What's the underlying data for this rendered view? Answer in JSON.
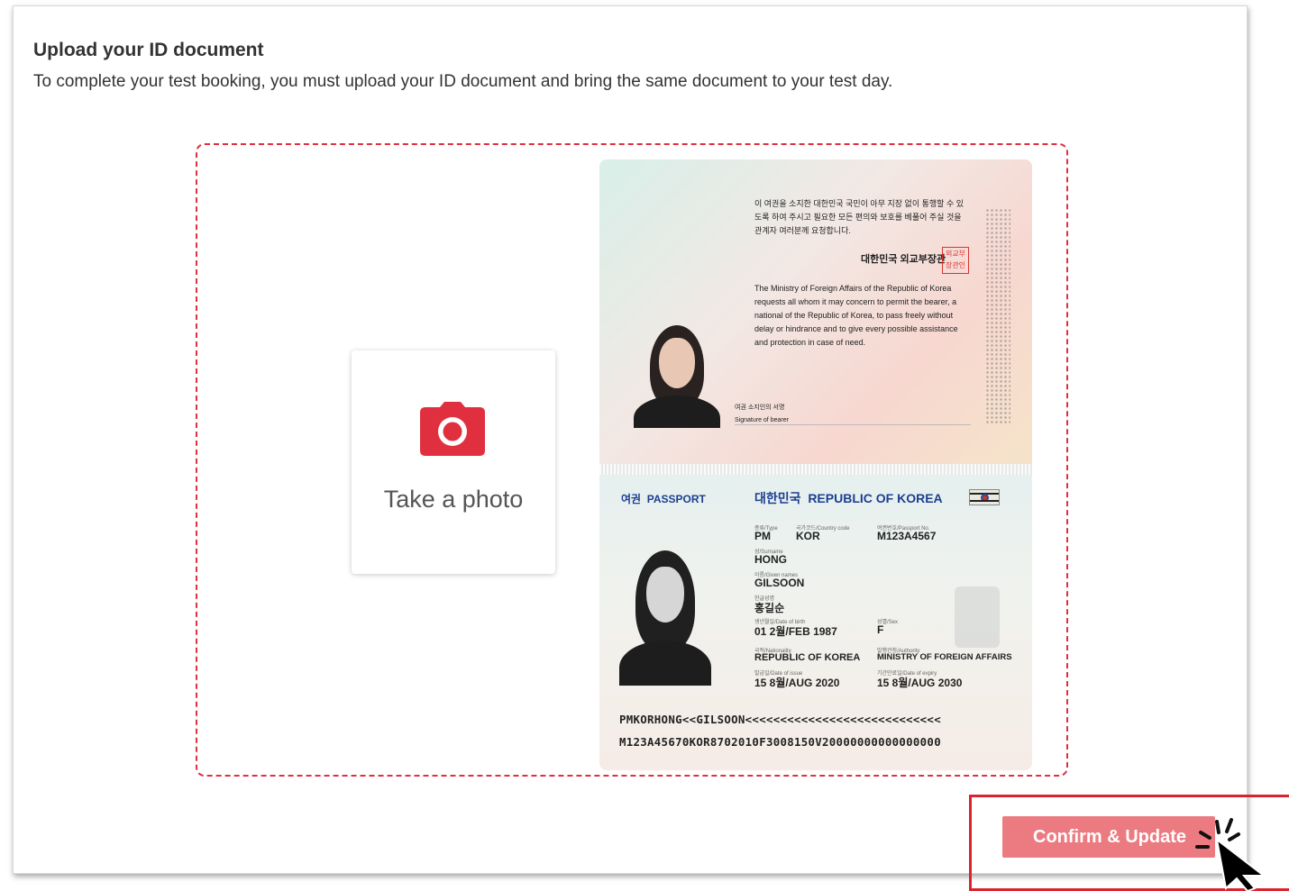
{
  "upload": {
    "title": "Upload your ID document",
    "subtitle": "To complete your test booking, you must upload your ID document and bring the same document to your test day."
  },
  "take_photo": {
    "label": "Take a photo",
    "icon": "camera-icon"
  },
  "passport": {
    "data_page": {
      "kr_label": "여권",
      "en_label": "PASSPORT",
      "country_kr": "대한민국",
      "country_en": "REPUBLIC OF KOREA",
      "fields": {
        "type": {
          "label": "종류/Type",
          "value": "PM"
        },
        "country_code": {
          "label": "국가코드/Country code",
          "value": "KOR"
        },
        "passport_no": {
          "label": "여권번호/Passport No.",
          "value": "M123A4567"
        },
        "surname": {
          "label": "성/Surname",
          "value": "HONG"
        },
        "given_names": {
          "label": "이름/Given names",
          "value": "GILSOON"
        },
        "korean_name": {
          "label": "한글성명",
          "value": "홍길순"
        },
        "date_of_birth": {
          "label": "생년월일/Date of birth",
          "value": "01 2월/FEB 1987"
        },
        "sex": {
          "label": "성별/Sex",
          "value": "F"
        },
        "nationality": {
          "label": "국적/Nationality",
          "value": "REPUBLIC OF KOREA"
        },
        "authority": {
          "label": "발행관청/Authority",
          "value": "MINISTRY OF FOREIGN AFFAIRS"
        },
        "date_of_issue": {
          "label": "발급일/Date of issue",
          "value": "15 8월/AUG 2020"
        },
        "date_of_expiry": {
          "label": "기간만료일/Date of expiry",
          "value": "15 8월/AUG 2030"
        }
      },
      "mrz_line1": "PMKORHONG<<GILSOON<<<<<<<<<<<<<<<<<<<<<<<<<<<<",
      "mrz_line2": "M123A45670KOR8702010F3008150V20000000000000000"
    },
    "request_page": {
      "kr_text": "이 여권을 소지한 대한민국 국민이 아무 지장 없이 통행할 수 있도록 하여 주시고 필요한 모든 편의와 보호를 베풀어 주실 것을 관계자 여러분께 요청합니다.",
      "minister": "대한민국 외교부장관",
      "seal": "외교부 장관인",
      "en_text": "The Ministry of Foreign Affairs of the Republic of Korea requests all whom it may concern to permit the bearer, a national of the Republic of Korea, to pass freely without delay or hindrance and to give every possible assistance and protection in case of need.",
      "signature_kr": "여권 소지인의 서명",
      "signature_en": "Signature of bearer"
    }
  },
  "actions": {
    "confirm_label": "Confirm & Update"
  },
  "colors": {
    "accent": "#e0303f",
    "button": "#ec7b81",
    "passport_blue": "#1b3f8f"
  }
}
